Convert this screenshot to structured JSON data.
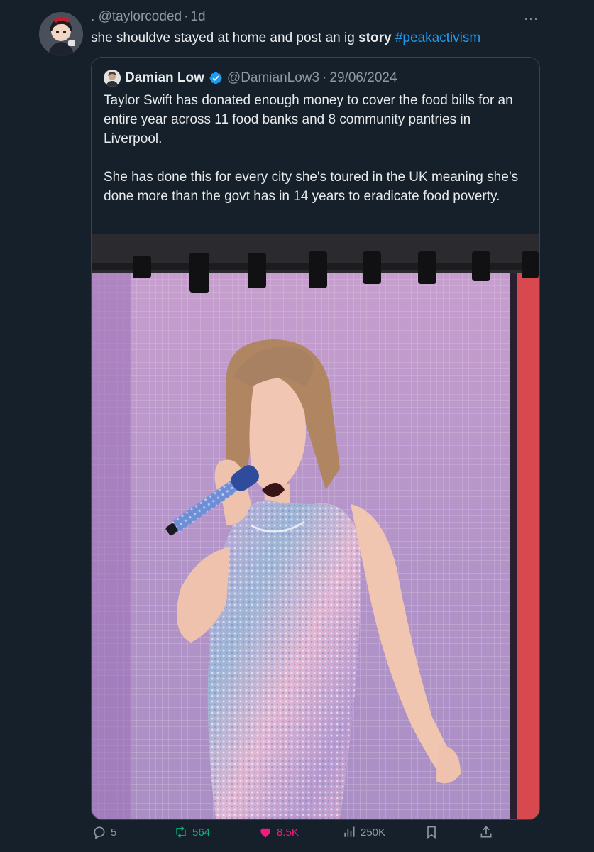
{
  "post": {
    "display_name": ".",
    "handle": "@taylorcoded",
    "separator": "·",
    "time": "1d",
    "text_plain": "she shouldve stayed at home and post an ig ",
    "text_bold": "story",
    "hashtag": "#peakactivism",
    "more_label": "···"
  },
  "quote": {
    "name": "Damian Low",
    "handle": "@DamianLow3",
    "separator": "·",
    "date": "29/06/2024",
    "paragraph1": "Taylor Swift has donated enough money to cover the food bills for an entire year across 11 food banks and 8 community pantries in Liverpool.",
    "paragraph2": "She has done this for every city she's toured in the UK meaning she’s done more than the govt has in 14 years to eradicate food poverty."
  },
  "actions": {
    "replies": "5",
    "reposts": "564",
    "likes": "8.5K",
    "views": "250K"
  },
  "colors": {
    "background": "#15202b",
    "text": "#e7e9ea",
    "muted": "#8b98a5",
    "link": "#1d9bf0",
    "repost": "#00ba7c",
    "like": "#f91880",
    "border": "#38444d"
  },
  "icons": {
    "reply": "reply-icon",
    "repost": "repost-icon",
    "like": "heart-icon",
    "views": "views-icon",
    "bookmark": "bookmark-icon",
    "share": "share-icon",
    "verified": "verified-badge-icon"
  }
}
